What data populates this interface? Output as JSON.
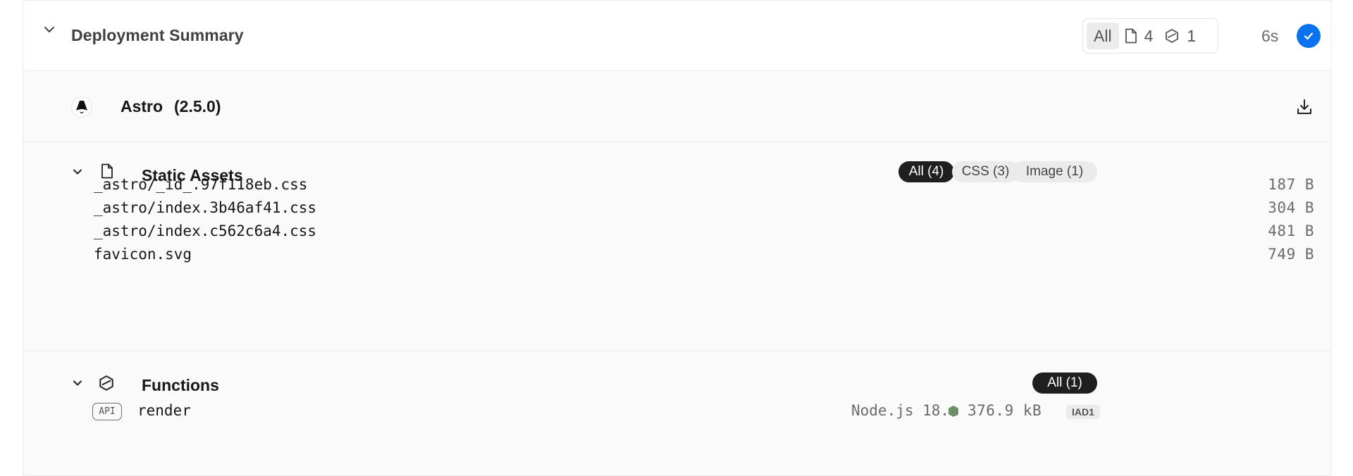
{
  "summary": {
    "title": "Deployment Summary",
    "filter": {
      "all_label": "All",
      "files_count": "4",
      "functions_count": "1"
    },
    "duration": "6s",
    "status_color": "#0a72ef"
  },
  "framework": {
    "name": "Astro",
    "version": "(2.5.0)"
  },
  "static_assets": {
    "title": "Static Assets",
    "filters": [
      "All (4)",
      "CSS (3)",
      "Image (1)"
    ],
    "files": [
      {
        "name": "_astro/_id_.97f118eb.css",
        "size": "187 B"
      },
      {
        "name": "_astro/index.3b46af41.css",
        "size": "304 B"
      },
      {
        "name": "_astro/index.c562c6a4.css",
        "size": "481 B"
      },
      {
        "name": "favicon.svg",
        "size": "749 B"
      }
    ]
  },
  "functions": {
    "title": "Functions",
    "filter": "All (1)",
    "items": [
      {
        "badge": "API",
        "name": "render",
        "runtime": "Node.js 18.x",
        "size": "376.9 kB",
        "region": "IAD1"
      }
    ]
  }
}
